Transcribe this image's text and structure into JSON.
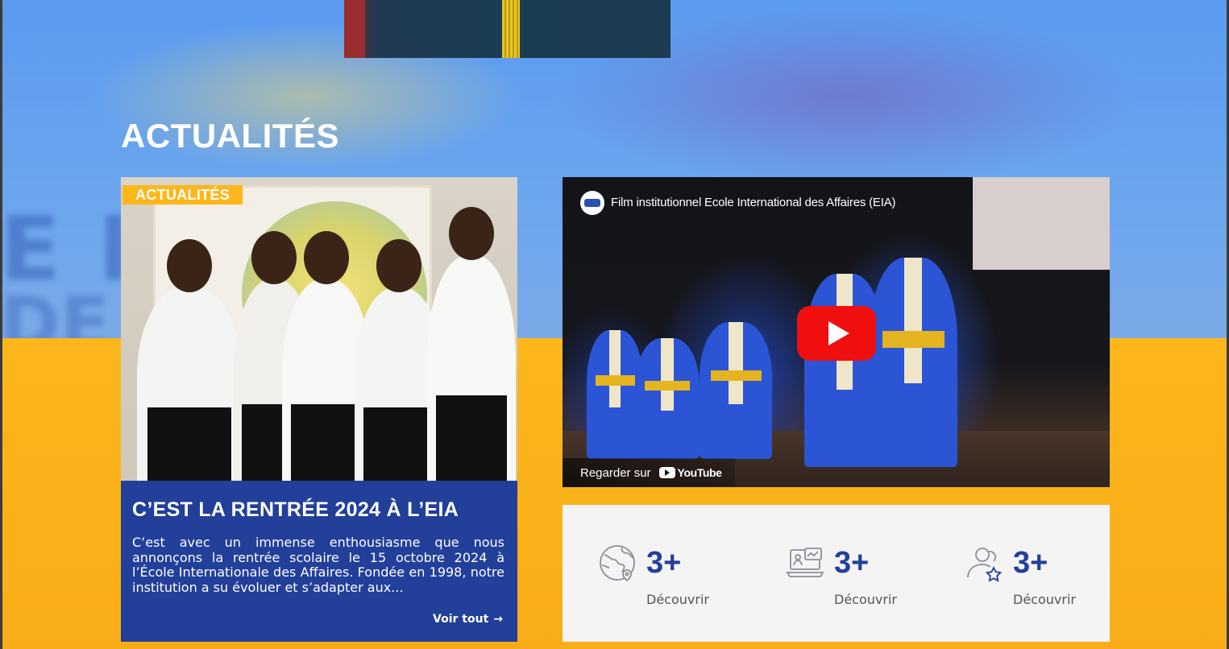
{
  "section_title": "ACTUALITÉS",
  "news": {
    "tag": "ACTUALITÉS",
    "headline": "C’EST LA RENTRÉE 2024 À L’EIA",
    "excerpt": "C’est avec un immense enthousiasme que nous annonçons la rentrée scolaire le 15 octobre 2024 à l’École Internationale des Affaires. Fondée en 1998, notre institution a su évoluer et s’adapter aux...",
    "link_label": "Voir tout",
    "link_arrow": "→"
  },
  "video": {
    "title": "Film institutionnel Ecole International des Affaires (EIA)",
    "watch_label": "Regarder sur",
    "platform": "YouTube"
  },
  "stats": [
    {
      "icon": "globe-icon",
      "value": "3+",
      "link": "Découvrir"
    },
    {
      "icon": "laptop-chart-icon",
      "value": "3+",
      "link": "Découvrir"
    },
    {
      "icon": "users-star-icon",
      "value": "3+",
      "link": "Découvrir"
    }
  ],
  "colors": {
    "primary_blue": "#223f99",
    "accent_yellow": "#fdb61b",
    "youtube_red": "#f00f0f"
  }
}
